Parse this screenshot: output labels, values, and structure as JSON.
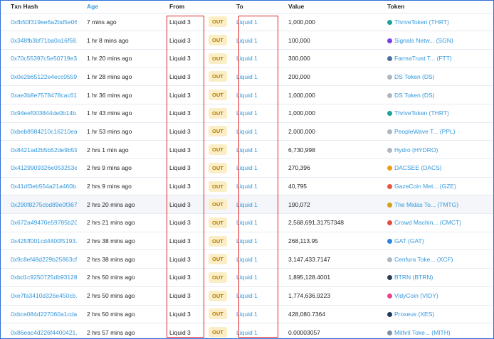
{
  "headers": {
    "hash": "Txn Hash",
    "age": "Age",
    "from": "From",
    "to": "To",
    "value": "Value",
    "token": "Token"
  },
  "rows": [
    {
      "hash": "0xfb50f319ee6a2bd5e06...",
      "age": "7 mins ago",
      "from": "Liquid 3",
      "dir": "OUT",
      "to": "Liquid 1",
      "value": "1,000,000",
      "token": "ThriveToken (THRT)",
      "icon": "thrive-token-icon",
      "color": "#1ba39c"
    },
    {
      "hash": "0x348fb3bf71ba0a16f58...",
      "age": "1 hr 8 mins ago",
      "from": "Liquid 3",
      "dir": "OUT",
      "to": "Liquid 1",
      "value": "100,000",
      "token": "Signals Netw... (SGN)",
      "icon": "signals-token-icon",
      "color": "#7b3fe4"
    },
    {
      "hash": "0x70c55397c5e50719e3...",
      "age": "1 hr 20 mins ago",
      "from": "Liquid 3",
      "dir": "OUT",
      "to": "Liquid 1",
      "value": "300,000",
      "token": "FarmaTrust T... (FTT)",
      "icon": "farmatrust-token-icon",
      "color": "#4a6fa5"
    },
    {
      "hash": "0x0e2b65122e4ecc0559...",
      "age": "1 hr 28 mins ago",
      "from": "Liquid 3",
      "dir": "OUT",
      "to": "Liquid 1",
      "value": "200,000",
      "token": "DS Token (DS)",
      "icon": "generic-token-icon",
      "color": "#b0b6c0"
    },
    {
      "hash": "0xae3b8e7578478cac61...",
      "age": "1 hr 36 mins ago",
      "from": "Liquid 3",
      "dir": "OUT",
      "to": "Liquid 1",
      "value": "1,000,000",
      "token": "DS Token (DS)",
      "icon": "generic-token-icon",
      "color": "#b0b6c0"
    },
    {
      "hash": "0x94eef003844de0b14b...",
      "age": "1 hr 43 mins ago",
      "from": "Liquid 3",
      "dir": "OUT",
      "to": "Liquid 1",
      "value": "1,000,000",
      "token": "ThriveToken (THRT)",
      "icon": "thrive-token-icon",
      "color": "#1ba39c"
    },
    {
      "hash": "0xbeb8984210c16210ea...",
      "age": "1 hr 53 mins ago",
      "from": "Liquid 3",
      "dir": "OUT",
      "to": "Liquid 1",
      "value": "2,000,000",
      "token": "PeopleWave T... (PPL)",
      "icon": "generic-token-icon",
      "color": "#b0b6c0"
    },
    {
      "hash": "0x8421ad2b5b52de9b59...",
      "age": "2 hrs 1 min ago",
      "from": "Liquid 3",
      "dir": "OUT",
      "to": "Liquid 1",
      "value": "6,730,998",
      "token": "Hydro (HYDRO)",
      "icon": "generic-token-icon",
      "color": "#b0b6c0"
    },
    {
      "hash": "0x4129909326e053253e...",
      "age": "2 hrs 9 mins ago",
      "from": "Liquid 3",
      "dir": "OUT",
      "to": "Liquid 1",
      "value": "270,396",
      "token": "DACSEE (DACS)",
      "icon": "dacsee-token-icon",
      "color": "#f39c12"
    },
    {
      "hash": "0x41df3eb554a21a460b...",
      "age": "2 hrs 9 mins ago",
      "from": "Liquid 3",
      "dir": "OUT",
      "to": "Liquid 1",
      "value": "40,795",
      "token": "GazeCoin Met... (GZE)",
      "icon": "gazecoin-token-icon",
      "color": "#e8543f"
    },
    {
      "hash": "0x290f8275cbd89e0f367...",
      "age": "2 hrs 20 mins ago",
      "from": "Liquid 3",
      "dir": "OUT",
      "to": "Liquid 1",
      "value": "190,072",
      "token": "The Midas To... (TMTG)",
      "icon": "midas-token-icon",
      "color": "#d4a017"
    },
    {
      "hash": "0x672a49470e59785b20...",
      "age": "2 hrs 21 mins ago",
      "from": "Liquid 3",
      "dir": "OUT",
      "to": "Liquid 1",
      "value": "2,568,691.31757348",
      "token": "Crowd Machin... (CMCT)",
      "icon": "crowdmachine-token-icon",
      "color": "#e74c3c"
    },
    {
      "hash": "0x425ff001cd4400f5193...",
      "age": "2 hrs 38 mins ago",
      "from": "Liquid 3",
      "dir": "OUT",
      "to": "Liquid 1",
      "value": "268,113.95",
      "token": "GAT (GAT)",
      "icon": "gat-token-icon",
      "color": "#2e86de"
    },
    {
      "hash": "0x9c8ef48d229b25863cf...",
      "age": "2 hrs 38 mins ago",
      "from": "Liquid 3",
      "dir": "OUT",
      "to": "Liquid 1",
      "value": "3,147,433.7147",
      "token": "Cenfura Toke... (XCF)",
      "icon": "generic-token-icon",
      "color": "#b0b6c0"
    },
    {
      "hash": "0xbd1c9250725db93128...",
      "age": "2 hrs 50 mins ago",
      "from": "Liquid 3",
      "dir": "OUT",
      "to": "Liquid 1",
      "value": "1,895,128.4001",
      "token": "BTRN (BTRN)",
      "icon": "btrn-token-icon",
      "color": "#2c3e50"
    },
    {
      "hash": "0xe7fa3410d326e450cb...",
      "age": "2 hrs 50 mins ago",
      "from": "Liquid 3",
      "dir": "OUT",
      "to": "Liquid 1",
      "value": "1,774,636.9223",
      "token": "VidyCoin (VIDY)",
      "icon": "vidycoin-token-icon",
      "color": "#e84393"
    },
    {
      "hash": "0xbce084d227060a1cda...",
      "age": "2 hrs 50 mins ago",
      "from": "Liquid 3",
      "dir": "OUT",
      "to": "Liquid 1",
      "value": "428,080.7364",
      "token": "Proxeus (XES)",
      "icon": "proxeus-token-icon",
      "color": "#1f3a5f"
    },
    {
      "hash": "0x86eac4d226f4400421...",
      "age": "2 hrs 57 mins ago",
      "from": "Liquid 3",
      "dir": "OUT",
      "to": "Liquid 1",
      "value": "0.00003057",
      "token": "Mithril Toke... (MITH)",
      "icon": "mithril-token-icon",
      "color": "#7f8fa6"
    }
  ]
}
